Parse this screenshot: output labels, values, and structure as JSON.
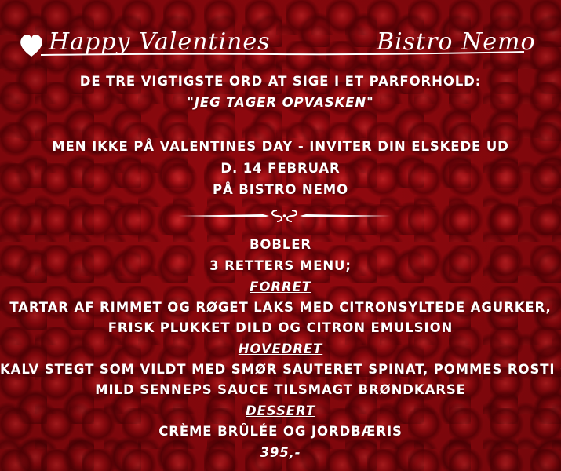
{
  "header": {
    "title_left": "Happy Valentines",
    "title_right": "Bistro Nemo"
  },
  "intro": {
    "line1": "DE TRE VIGTIGSTE ORD AT SIGE I ET PARFORHOLD:",
    "quote": "\"JEG TAGER OPVASKEN\"",
    "line3_pre": "MEN ",
    "line3_emph": "IKKE",
    "line3_post": " PÅ VALENTINES DAY - INVITER DIN ELSKEDE UD",
    "date": "D. 14 FEBRUAR",
    "venue": "PÅ BISTRO NEMO"
  },
  "menu": {
    "bubbles": "BOBLER",
    "courses": "3 RETTERS MENU;",
    "starter_label": "FORRET",
    "starter_line1": "TARTAR AF RIMMET OG RØGET LAKS MED CITRONSYLTEDE AGURKER,",
    "starter_line2": "FRISK PLUKKET DILD OG CITRON EMULSION",
    "main_label": "HOVEDRET",
    "main_line1": "KALV STEGT SOM VILDT MED SMØR SAUTERET SPINAT, POMMES ROSTI OG",
    "main_line2": "MILD SENNEPS SAUCE TILSMAGT BRØNDKARSE",
    "dessert_label": "DESSERT",
    "dessert_line1": "CRÈME BRÛLÉE OG JORDBÆRIS",
    "price": "395,-"
  },
  "colors": {
    "text": "#ffffff",
    "background": "#9c0a10"
  },
  "icons": [
    "heart-icon",
    "flourish-divider-icon"
  ]
}
